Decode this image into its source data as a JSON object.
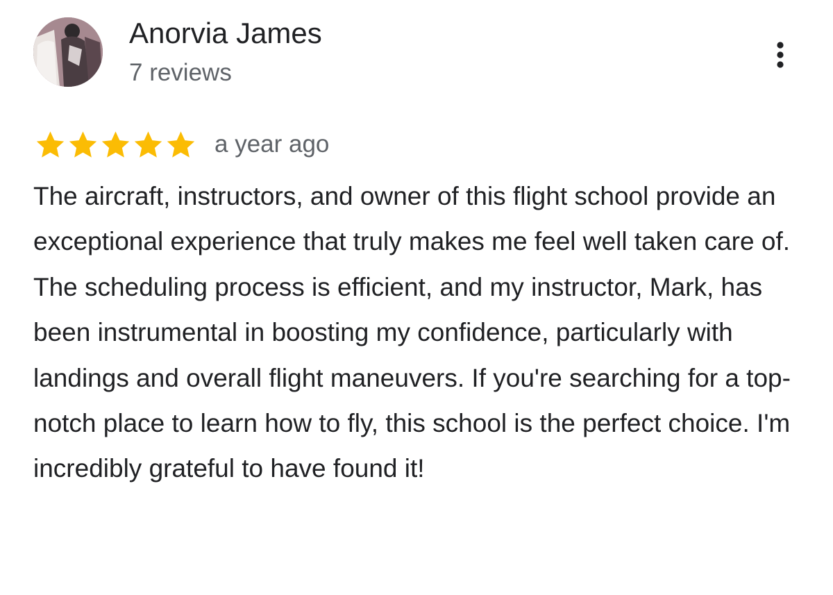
{
  "reviewer": {
    "name": "Anorvia James",
    "review_count": "7 reviews",
    "avatar": "profile-photo"
  },
  "menu": {
    "icon": "more-vert-icon"
  },
  "rating": {
    "stars": 5,
    "max_stars": 5,
    "star_color": "#fbbc04",
    "star_icon": "star-icon",
    "date": "a year ago"
  },
  "review": {
    "text": "The aircraft, instructors, and owner of this flight school provide an exceptional experience that truly makes me feel well taken care of. The scheduling process is efficient, and my instructor, Mark, has been instrumental in boosting my confidence, particularly with landings and overall flight maneuvers. If you're searching for a top-notch place to learn how to fly, this school is the perfect choice. I'm incredibly grateful to have found it!"
  }
}
